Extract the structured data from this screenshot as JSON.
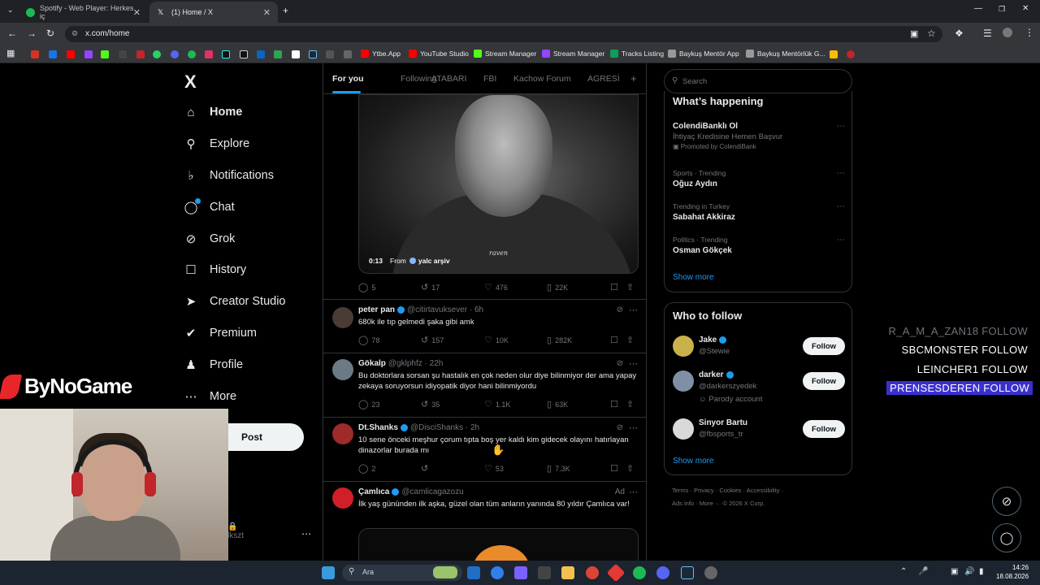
{
  "browser": {
    "tabs": [
      {
        "title": "Spotify - Web Player: Herkes iç",
        "active": false,
        "favicon_color": "#1db954"
      },
      {
        "title": "(1) Home / X",
        "active": true,
        "favicon_color": "#ffffff"
      }
    ],
    "url": "x.com/home",
    "bookmarks": [
      "Ytbe.App",
      "YouTube Studio",
      "Stream Manager",
      "Stream Manager",
      "Tracks Listing",
      "Baykuş Mentör App",
      "Baykuş Mentörlük G..."
    ]
  },
  "sidebar": {
    "logo": "X",
    "items": [
      {
        "label": "Home",
        "icon": "home-icon",
        "glyph": "⌂",
        "active": true
      },
      {
        "label": "Explore",
        "icon": "search-icon",
        "glyph": "⌕"
      },
      {
        "label": "Notifications",
        "icon": "bell-icon",
        "glyph": "⍾"
      },
      {
        "label": "Chat",
        "icon": "chat-icon",
        "glyph": "◯"
      },
      {
        "label": "Grok",
        "icon": "grok-icon",
        "glyph": "⊘"
      },
      {
        "label": "History",
        "icon": "bookmark-icon",
        "glyph": "☐"
      },
      {
        "label": "Creator Studio",
        "icon": "rocket-icon",
        "glyph": "➶"
      },
      {
        "label": "Premium",
        "icon": "premium-icon",
        "glyph": "✔"
      },
      {
        "label": "Profile",
        "icon": "person-icon",
        "glyph": "☺"
      },
      {
        "label": "More",
        "icon": "more-icon",
        "glyph": "⋯"
      }
    ],
    "post_label": "Post",
    "account_handle": "lkszt"
  },
  "overlay_brand": "ByNoGame",
  "feed": {
    "tabs": [
      "For you",
      "Following",
      "ATABARI",
      "FBI",
      "Kachow Forum",
      "AGRESİ"
    ],
    "video": {
      "time": "0:13",
      "from_label": "From",
      "source": "yalc arşiv",
      "watermark": "raven",
      "stats": {
        "replies": "5",
        "reposts": "17",
        "likes": "476",
        "views": "22K"
      }
    },
    "tweets": [
      {
        "name": "peter pan",
        "handle": "@citirtavuksever",
        "time": "6h",
        "text": "680k ile tıp gelmedi şaka gibi amk",
        "stats": {
          "replies": "78",
          "reposts": "157",
          "likes": "10K",
          "views": "282K"
        },
        "avatar_color": "#4a3b35"
      },
      {
        "name": "Gökalp",
        "handle": "@gklphfz",
        "time": "22h",
        "text": "Bu doktorlara sorsan şu hastalık en çok neden olur diye bilinmiyor der ama yapay zekaya soruyorsun idiyopatik diyor hani bilinmiyordu",
        "stats": {
          "replies": "23",
          "reposts": "35",
          "likes": "1.1K",
          "views": "63K"
        },
        "avatar_color": "#6b7a85"
      },
      {
        "name": "Dt.Shanks",
        "handle": "@DisciShanks",
        "time": "2h",
        "text": "10 sene önceki meşhur çorum tıpta boş yer kaldı kim gidecek olayını hatırlayan dinazorlar burada mı",
        "stats": {
          "replies": "2",
          "reposts": "",
          "likes": "53",
          "views": "7.3K"
        },
        "avatar_color": "#9e2a2a"
      },
      {
        "name": "Çamlıca",
        "handle": "@camlicagazozu",
        "ad_label": "Ad",
        "text": "İlk yaş gününden ilk aşka, güzel olan tüm anların yanında 80 yıldır Çamlıca var!",
        "avatar_color": "#d11f2a"
      }
    ]
  },
  "right": {
    "search_placeholder": "Search",
    "whats_happening": {
      "title": "What’s happening",
      "trends": [
        {
          "meta": "",
          "name": "ColendiBanklı Ol",
          "sub": "İhtiyaç Kredisine Hemen Başvur",
          "promo": "Promoted by ColendiBank"
        },
        {
          "meta": "Sports · Trending",
          "name": "Oğuz Aydın"
        },
        {
          "meta": "Trending in Turkey",
          "name": "Sabahat Akkiraz"
        },
        {
          "meta": "Politics · Trending",
          "name": "Osman Gökçek"
        }
      ],
      "show_more": "Show more"
    },
    "who_to_follow": {
      "title": "Who to follow",
      "users": [
        {
          "name": "Jake",
          "handle": "@Stewie",
          "extra": "",
          "avatar_color": "#c9b24a"
        },
        {
          "name": "darker",
          "handle": "@darkerszyedek",
          "extra": "Parody account",
          "avatar_color": "#7e8fa6"
        },
        {
          "name": "Sinyor Bartu",
          "handle": "@fbsports_tr",
          "extra": "",
          "avatar_color": "#d9d9d9"
        }
      ],
      "follow_label": "Follow",
      "show_more": "Show more"
    },
    "footer": {
      "line1": "Terms  ·  Privacy  ·  Cookies  ·  Accessibility  ·",
      "line2": "Ads info  ·  More ···  © 2026 X Corp."
    }
  },
  "stream_overlay": {
    "rows": [
      {
        "text": "R_A_M_A_ZAN18  FOLLOW",
        "color": "#6e7379",
        "highlight": false
      },
      {
        "text": "SBCMONSTER  FOLLOW",
        "color": "#ffffff",
        "highlight": false
      },
      {
        "text": "LEINCHER1  FOLLOW",
        "color": "#ffffff",
        "highlight": false
      },
      {
        "text": "PRENSESDEREN  FOLLOW",
        "color": "#ffffff",
        "highlight": true
      }
    ]
  },
  "taskbar": {
    "search_label": "Ara",
    "time": "14:26",
    "date": "18.08.2026"
  },
  "colors": {
    "accent": "#1d9bf0",
    "background": "#000000",
    "border": "#2f3336"
  }
}
